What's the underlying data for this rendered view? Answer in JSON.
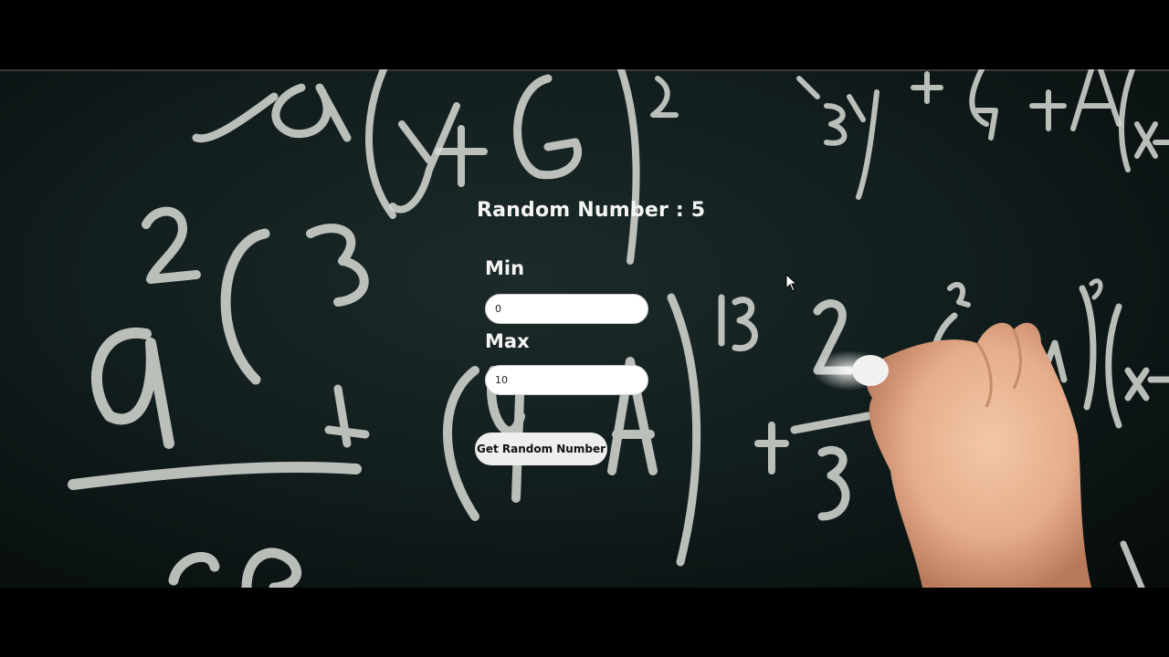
{
  "app": {
    "result_label": "Random Number : 5",
    "min_label": "Min",
    "min_value": "0",
    "max_label": "Max",
    "max_value": "10",
    "button_label": "Get Random Number"
  },
  "colors": {
    "backdrop": "#000000",
    "chalkboard": "#142020",
    "chalk": "#d8dcd6",
    "text": "#f4f4f4",
    "input_bg": "#ffffff",
    "button_bg": "#eeeeee"
  },
  "icons": {
    "pointer": "mouse-cursor-icon"
  }
}
